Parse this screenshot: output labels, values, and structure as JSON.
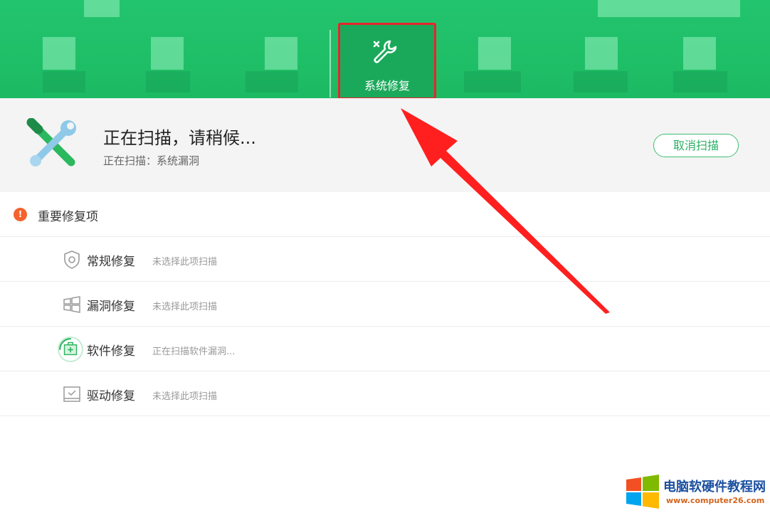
{
  "toolbar": {
    "active_tool_label": "系统修复",
    "accent": "#1fbf68",
    "highlight_color": "#e8242b"
  },
  "scan": {
    "title": "正在扫描，请稍候...",
    "subtitle": "正在扫描：系统漏洞",
    "cancel_label": "取消扫描"
  },
  "section": {
    "alert_glyph": "!",
    "label": "重要修复项"
  },
  "items": [
    {
      "icon": "shield-icon",
      "name": "常规修复",
      "status": "未选择此项扫描"
    },
    {
      "icon": "windows-icon",
      "name": "漏洞修复",
      "status": "未选择此项扫描"
    },
    {
      "icon": "software-box-icon",
      "name": "软件修复",
      "status": "正在扫描软件漏洞..."
    },
    {
      "icon": "driver-icon",
      "name": "驱动修复",
      "status": "未选择此项扫描"
    }
  ],
  "watermark": {
    "title": "电脑软硬件教程网",
    "url": "www.computer26.com"
  }
}
